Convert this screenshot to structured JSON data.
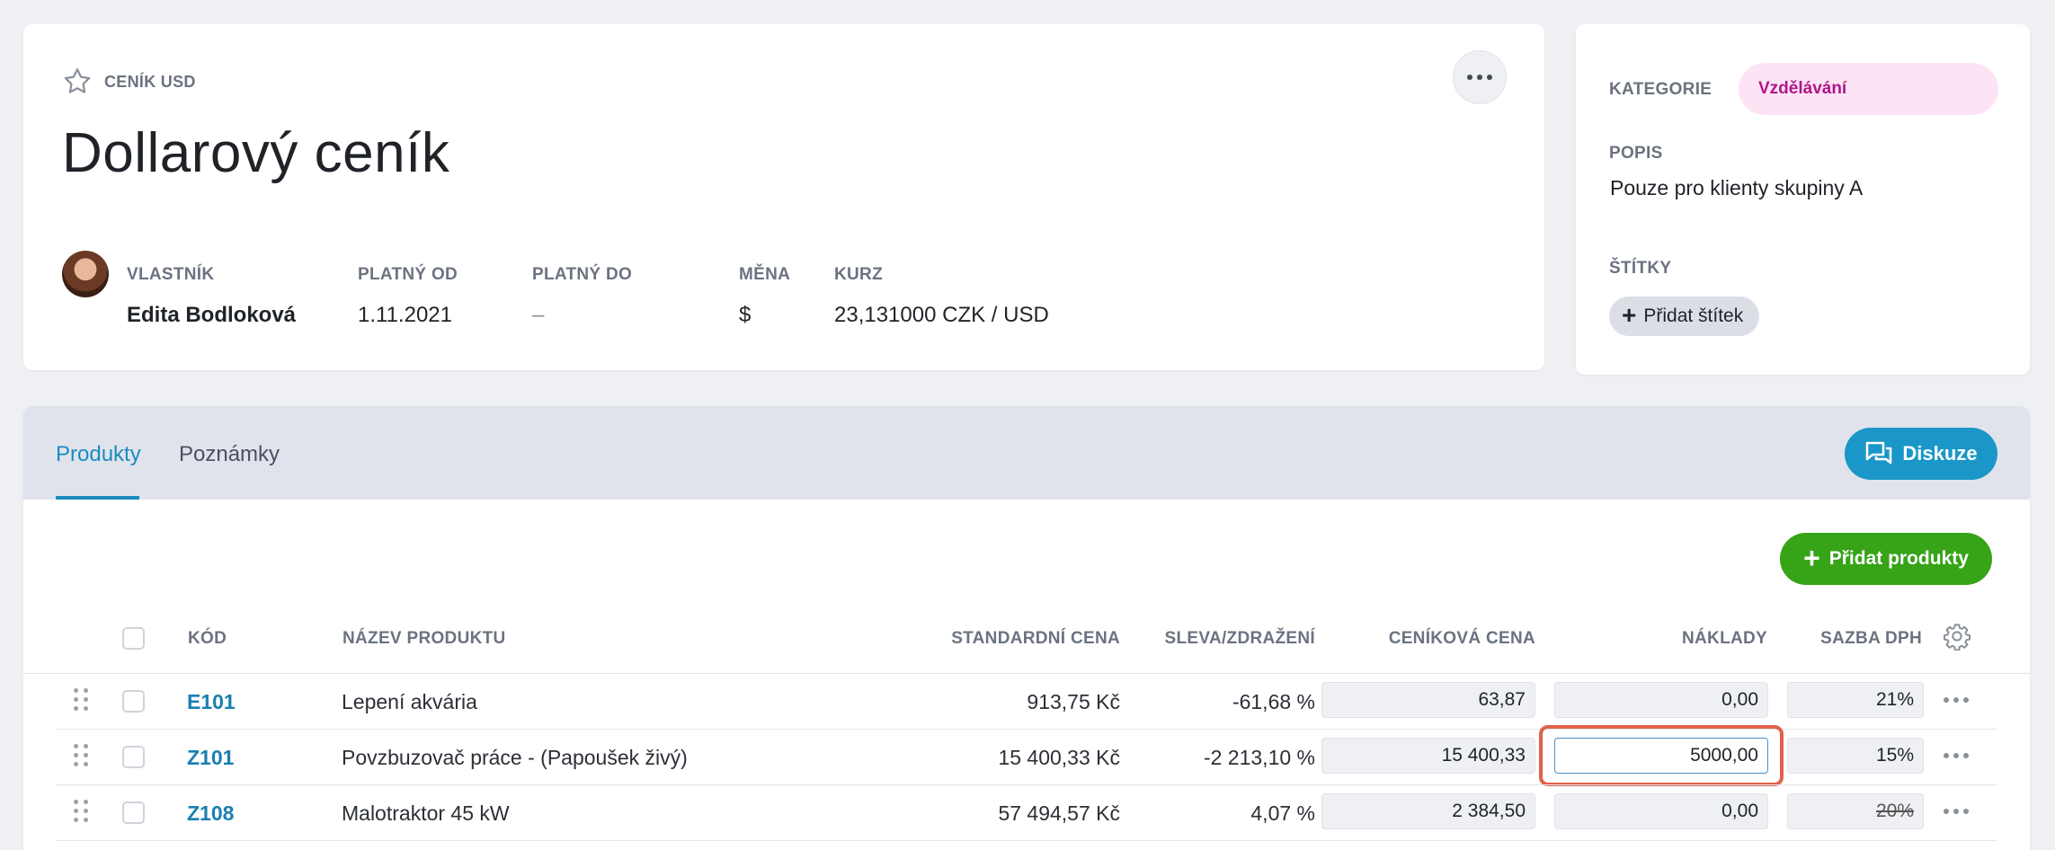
{
  "header": {
    "overline": "CENÍK USD",
    "title": "Dollarový ceník",
    "meta": {
      "owner_label": "VLASTNÍK",
      "owner_value": "Edita Bodloková",
      "valid_from_label": "PLATNÝ OD",
      "valid_from_value": "1.11.2021",
      "valid_to_label": "PLATNÝ DO",
      "valid_to_value": "–",
      "currency_label": "MĚNA",
      "currency_value": "$",
      "rate_label": "KURZ",
      "rate_value": "23,131000 CZK / USD"
    }
  },
  "side": {
    "category_label": "KATEGORIE",
    "category_value": "Vzdělávání",
    "description_label": "POPIS",
    "description_value": "Pouze pro klienty skupiny A",
    "tags_label": "ŠTÍTKY",
    "add_tag_label": "Přidat štítek"
  },
  "tabs": [
    {
      "label": "Produkty",
      "active": true
    },
    {
      "label": "Poznámky",
      "active": false
    }
  ],
  "discuss_label": "Diskuze",
  "add_products_label": "Přidat produkty",
  "table": {
    "columns": {
      "code": "KÓD",
      "name": "NÁZEV PRODUKTU",
      "standard_price": "STANDARDNÍ CENA",
      "discount": "SLEVA/ZDRAŽENÍ",
      "list_price": "CENÍKOVÁ CENA",
      "costs": "NÁKLADY",
      "vat": "SAZBA DPH"
    },
    "rows": [
      {
        "code": "E101",
        "name": "Lepení akvária",
        "standard_price": "913,75 Kč",
        "discount": "-61,68 %",
        "list_price": "63,87",
        "costs": "0,00",
        "vat": "21%"
      },
      {
        "code": "Z101",
        "name": "Povzbuzovač práce - (Papoušek živý)",
        "standard_price": "15 400,33 Kč",
        "discount": "-2 213,10 %",
        "list_price": "15 400,33",
        "costs": "5000,00",
        "vat": "15%"
      },
      {
        "code": "Z108",
        "name": "Malotraktor 45 kW",
        "standard_price": "57 494,57 Kč",
        "discount": "4,07 %",
        "list_price": "2 384,50",
        "costs": "0,00",
        "vat": "20%"
      }
    ]
  },
  "colors": {
    "accent": "#1a8cbf",
    "add_button": "#37a317",
    "category_pill": "#fde4f5",
    "highlight": "#e0624a"
  }
}
